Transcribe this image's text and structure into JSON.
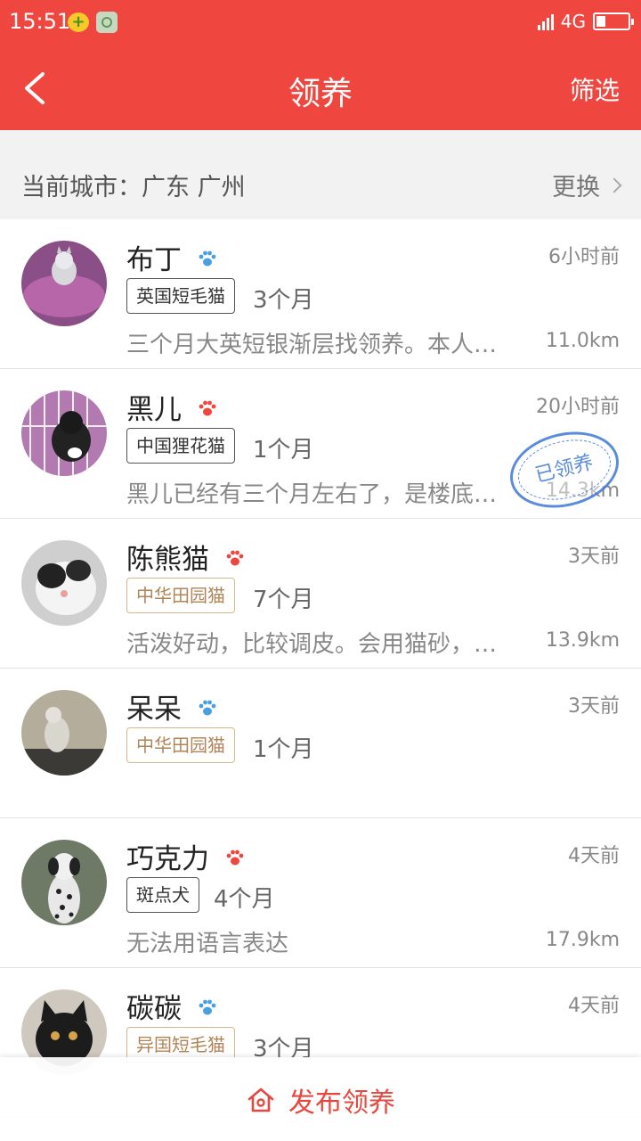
{
  "status_bar": {
    "time": "15:51",
    "network": "4G",
    "network_small": "4G"
  },
  "nav": {
    "title": "领养",
    "filter_label": "筛选"
  },
  "city": {
    "label": "当前城市：广东 广州",
    "change_label": "更换"
  },
  "items": [
    {
      "name": "布丁",
      "paw_color": "#4a9fe0",
      "time": "6小时前",
      "breed": "英国短毛猫",
      "breed_style": "dark",
      "age": "3个月",
      "desc": "三个月大英短银渐层找领养。本人…",
      "distance": "11.0km"
    },
    {
      "name": "黑儿",
      "paw_color": "#ef473f",
      "time": "20小时前",
      "breed": "中国狸花猫",
      "breed_style": "dark",
      "age": "1个月",
      "desc": "黑儿已经有三个月左右了，是楼底…",
      "distance": "14.3km",
      "stamp": "已领养"
    },
    {
      "name": "陈熊猫",
      "paw_color": "#ef473f",
      "time": "3天前",
      "breed": "中华田园猫",
      "breed_style": "gold",
      "age": "7个月",
      "desc": "活泼好动，比较调皮。会用猫砂，…",
      "distance": "13.9km"
    },
    {
      "name": "呆呆",
      "paw_color": "#4a9fe0",
      "time": "3天前",
      "breed": "中华田园猫",
      "breed_style": "gold",
      "age": "1个月",
      "desc": "",
      "distance": ""
    },
    {
      "name": "巧克力",
      "paw_color": "#ef473f",
      "time": "4天前",
      "breed": "斑点犬",
      "breed_style": "dark",
      "age": "4个月",
      "desc": "无法用语言表达",
      "distance": "17.9km"
    },
    {
      "name": "碳碳",
      "paw_color": "#4a9fe0",
      "time": "4天前",
      "breed": "异国短毛猫",
      "breed_style": "gold",
      "age": "3个月",
      "desc": "",
      "distance": ""
    }
  ],
  "bottom": {
    "publish_label": "发布领养"
  },
  "colors": {
    "primary": "#ef473f",
    "stamp": "#3f79d6"
  }
}
